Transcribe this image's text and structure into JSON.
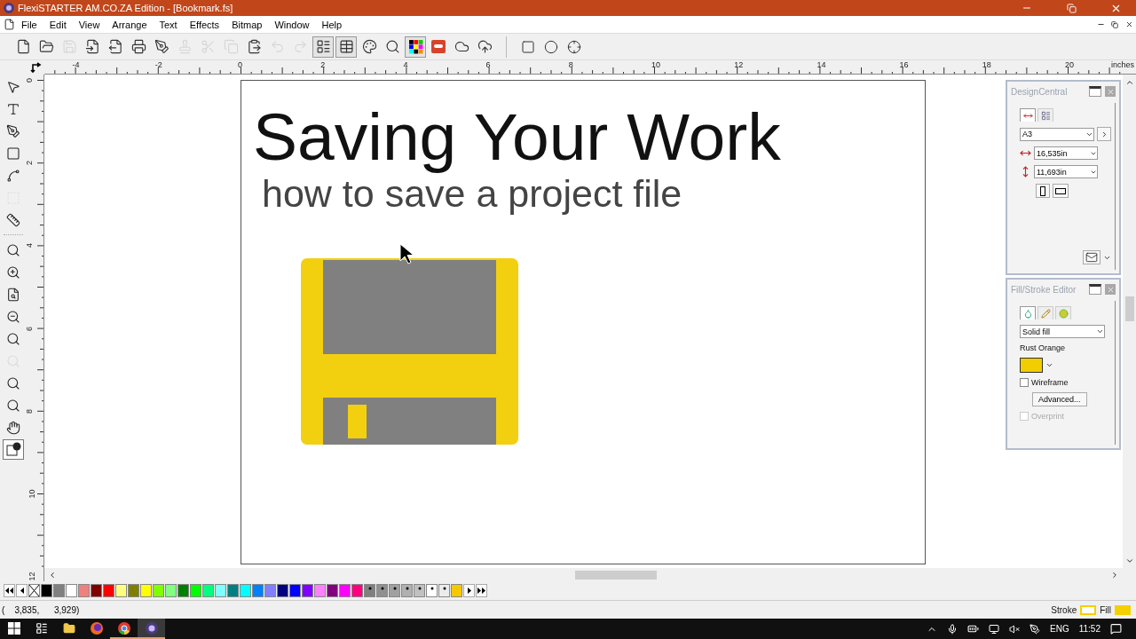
{
  "window": {
    "title": "FlexiSTARTER AM.CO.ZA Edition - [Bookmark.fs]"
  },
  "menu": [
    "File",
    "Edit",
    "View",
    "Arrange",
    "Text",
    "Effects",
    "Bitmap",
    "Window",
    "Help"
  ],
  "toolbar": {
    "groups": [
      [
        {
          "disabled": false,
          "pressed": false
        },
        {
          "disabled": false,
          "pressed": false
        },
        {
          "disabled": true,
          "pressed": false
        },
        {
          "disabled": false,
          "pressed": false
        },
        {
          "disabled": false,
          "pressed": false
        },
        {
          "disabled": false,
          "pressed": false
        },
        {
          "disabled": false,
          "pressed": false
        },
        {
          "disabled": true,
          "pressed": false
        },
        {
          "disabled": true,
          "pressed": false
        },
        {
          "disabled": true,
          "pressed": false
        },
        {
          "disabled": false,
          "pressed": false
        },
        {
          "disabled": true,
          "pressed": false
        },
        {
          "disabled": true,
          "pressed": false
        },
        {
          "disabled": false,
          "pressed": true
        },
        {
          "disabled": false,
          "pressed": true
        },
        {
          "disabled": false,
          "pressed": false
        },
        {
          "disabled": false,
          "pressed": false
        },
        {
          "disabled": false,
          "pressed": true
        },
        {
          "disabled": false,
          "pressed": false
        },
        {
          "disabled": false,
          "pressed": false
        },
        {
          "disabled": false,
          "pressed": false
        }
      ],
      [
        {
          "disabled": false,
          "pressed": false
        },
        {
          "disabled": false,
          "pressed": false
        },
        {
          "disabled": false,
          "pressed": false
        }
      ]
    ]
  },
  "rulers": {
    "horizontal_labels": [
      "-4",
      "-2",
      "0",
      "2",
      "4",
      "6",
      "8",
      "10",
      "12",
      "14",
      "16",
      "18",
      "20"
    ],
    "unit": "inches",
    "vertical_labels": [
      "0",
      "2",
      "4",
      "6",
      "8",
      "10",
      "12"
    ]
  },
  "tools": [
    {
      "selected": false,
      "disabled": false
    },
    {
      "selected": false,
      "disabled": false
    },
    {
      "selected": false,
      "disabled": false
    },
    {
      "selected": false,
      "disabled": false
    },
    {
      "selected": false,
      "disabled": false
    },
    {
      "selected": false,
      "disabled": true
    },
    {
      "selected": false,
      "disabled": false
    },
    {
      "selected": false,
      "disabled": false
    },
    {
      "selected": false,
      "disabled": false
    },
    {
      "selected": false,
      "disabled": false
    },
    {
      "selected": false,
      "disabled": false
    },
    {
      "selected": false,
      "disabled": false
    },
    {
      "selected": false,
      "disabled": true
    },
    {
      "selected": false,
      "disabled": false
    },
    {
      "selected": false,
      "disabled": false
    },
    {
      "selected": false,
      "disabled": false
    },
    {
      "selected": true,
      "disabled": false
    }
  ],
  "page": {
    "title": "Saving Your Work",
    "subtitle": "how to save a project file"
  },
  "design_central": {
    "title": "DesignCentral",
    "tabs": [
      {
        "selected": true
      },
      {
        "selected": false
      }
    ],
    "size": "A3",
    "width": "16,535in",
    "height": "11,693in"
  },
  "fill_stroke": {
    "title": "Fill/Stroke Editor",
    "tabs": [
      {
        "selected": true
      },
      {
        "selected": false
      },
      {
        "selected": false
      }
    ],
    "fill_type": "Solid fill",
    "color_name": "Rust Orange",
    "wireframe": {
      "label": "Wireframe",
      "checked": false,
      "disabled": false
    },
    "advanced": "Advanced...",
    "overprint": {
      "label": "Overprint",
      "checked": false,
      "disabled": true
    }
  },
  "palette": [
    {
      "kind": "none"
    },
    {
      "kind": "color",
      "color": "#000000"
    },
    {
      "kind": "color",
      "color": "#808080"
    },
    {
      "kind": "color",
      "color": "#ffffff"
    },
    {
      "kind": "color",
      "color": "#f08080"
    },
    {
      "kind": "color",
      "color": "#800000"
    },
    {
      "kind": "color",
      "color": "#ff0000"
    },
    {
      "kind": "color",
      "color": "#ffff80"
    },
    {
      "kind": "color",
      "color": "#808000"
    },
    {
      "kind": "color",
      "color": "#ffff00"
    },
    {
      "kind": "color",
      "color": "#80ff00"
    },
    {
      "kind": "color",
      "color": "#80ff80"
    },
    {
      "kind": "color",
      "color": "#008000"
    },
    {
      "kind": "color",
      "color": "#00ff00"
    },
    {
      "kind": "color",
      "color": "#00ff80"
    },
    {
      "kind": "color",
      "color": "#80ffff"
    },
    {
      "kind": "color",
      "color": "#008080"
    },
    {
      "kind": "color",
      "color": "#00ffff"
    },
    {
      "kind": "color",
      "color": "#0080ff"
    },
    {
      "kind": "color",
      "color": "#8080ff"
    },
    {
      "kind": "color",
      "color": "#000080"
    },
    {
      "kind": "color",
      "color": "#0000ff"
    },
    {
      "kind": "color",
      "color": "#8000ff"
    },
    {
      "kind": "color",
      "color": "#ff80ff"
    },
    {
      "kind": "color",
      "color": "#800080"
    },
    {
      "kind": "color",
      "color": "#ff00ff"
    },
    {
      "kind": "color",
      "color": "#ff0080"
    },
    {
      "kind": "spot",
      "color": "#808080"
    },
    {
      "kind": "spot",
      "color": "#909090"
    },
    {
      "kind": "spot",
      "color": "#a0a0a0"
    },
    {
      "kind": "spot",
      "color": "#b0b0b0"
    },
    {
      "kind": "spot",
      "color": "#c0c0c0"
    },
    {
      "kind": "spot",
      "color": "#ffffff"
    },
    {
      "kind": "spot",
      "color": "#ececec"
    },
    {
      "kind": "color",
      "color": "#f5c800"
    }
  ],
  "status_bar": {
    "coordinates": "(    3,835,      3,929)",
    "stroke_label": "Stroke",
    "fill_label": "Fill"
  },
  "taskbar": {
    "apps": [
      {
        "running": false,
        "selected": false
      },
      {
        "running": false,
        "selected": false
      },
      {
        "running": true,
        "selected": false
      },
      {
        "running": true,
        "selected": true
      }
    ],
    "language": "ENG",
    "time": "11:52"
  }
}
